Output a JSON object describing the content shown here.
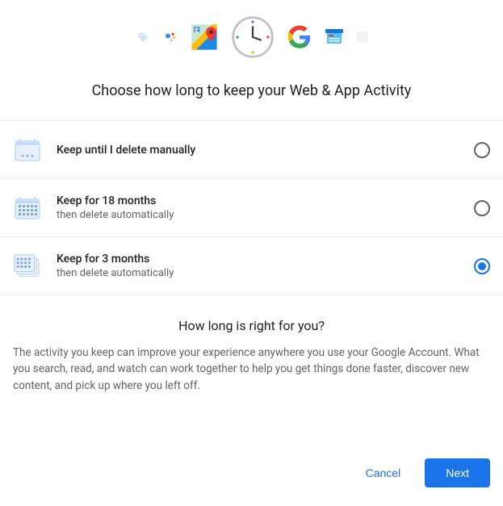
{
  "header": {
    "title": "Choose how long to keep your Web & App Activity"
  },
  "options": [
    {
      "label": "Keep until I delete manually",
      "sub": "",
      "selected": false
    },
    {
      "label": "Keep for 18 months",
      "sub": "then delete automatically",
      "selected": false
    },
    {
      "label": "Keep for 3 months",
      "sub": "then delete automatically",
      "selected": true
    }
  ],
  "info": {
    "title": "How long is right for you?",
    "body": "The activity you keep can improve your experience anywhere you use your Google Account. What you search, read, and watch can work together to help you get things done faster, discover new content, and pick up where you left off."
  },
  "footer": {
    "cancel_label": "Cancel",
    "next_label": "Next"
  }
}
